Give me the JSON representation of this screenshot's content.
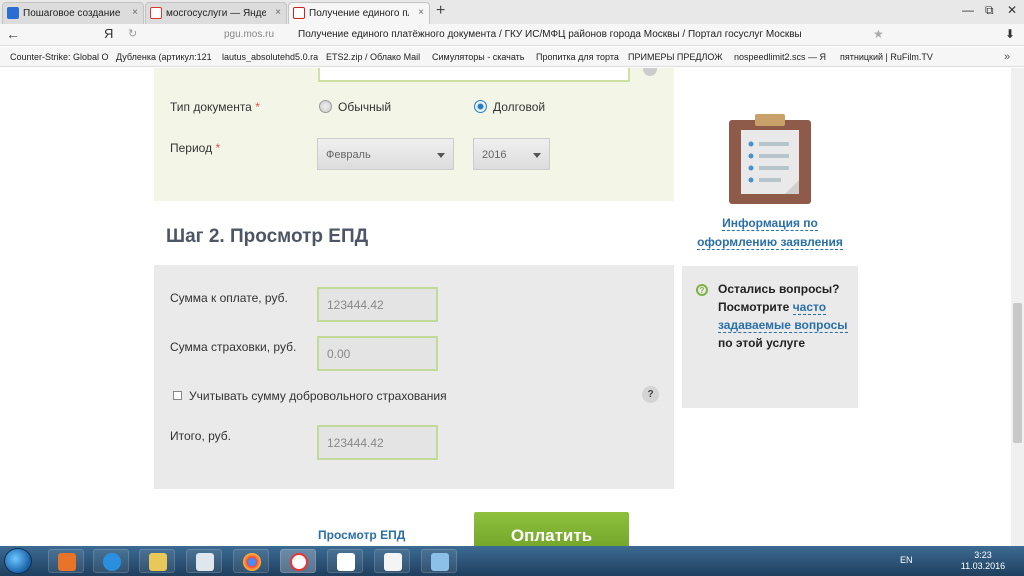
{
  "browser": {
    "tabs": [
      {
        "label": "Пошаговое создание проект",
        "close": "×"
      },
      {
        "label": "мосгосуслуги — Яндекс: нашл",
        "close": "×"
      },
      {
        "label": "Получение единого плат",
        "close": "×"
      }
    ],
    "new_tab": "+",
    "window_controls": {
      "minimize": "—",
      "restore": "⧉",
      "close": "✕"
    },
    "address": {
      "back": "←",
      "ya": "Я",
      "reload": "↻",
      "domain": "pgu.mos.ru",
      "page_title": "Получение единого платёжного документа / ГКУ ИС/МФЦ районов города Москвы / Портал госуслуг Москвы",
      "star": "★",
      "download": "⬇"
    },
    "bookmarks": [
      "Counter-Strike: Global O",
      "Дубленка (артикул:121",
      "lautus_absolutehd5.0.ra",
      "ETS2.zip / Облако Mail",
      "Симуляторы - скачать",
      "Пропитка для торта",
      "ПРИМЕРЫ ПРЕДЛОЖ",
      "nospeedlimit2.scs — Я",
      "пятницкий | RuFilm.TV"
    ],
    "bookmarks_more": "»"
  },
  "form": {
    "doc_type": {
      "label": "Тип документа",
      "required_mark": "*",
      "options": [
        "Обычный",
        "Долговой"
      ],
      "selected": "Долговой"
    },
    "period": {
      "label": "Период",
      "required_mark": "*",
      "month": "Февраль",
      "year": "2016"
    },
    "step2_title": "Шаг 2. Просмотр ЕПД",
    "sum_to_pay": {
      "label": "Сумма к оплате, руб.",
      "value": "123444.42"
    },
    "insurance_sum": {
      "label": "Сумма страховки, руб.",
      "value": "0.00"
    },
    "voluntary_insurance": {
      "label": "Учитывать сумму добровольного страхования",
      "checked": false,
      "help": "?"
    },
    "total": {
      "label": "Итого, руб.",
      "value": "123444.42"
    },
    "view_link": "Просмотр ЕПД",
    "pay_button": "Оплатить"
  },
  "sidebar": {
    "info_link_line1": "Информация по",
    "info_link_line2": "оформлению заявления",
    "help": {
      "icon": "?",
      "text_before": "Остались вопросы? Посмотрите",
      "link": "часто задаваемые вопросы",
      "text_after": "по этой услуге"
    }
  },
  "taskbar": {
    "lang": "EN",
    "time": "3:23",
    "date": "11.03.2016"
  },
  "colors": {
    "accent_green": "#7cb342",
    "link_blue": "#2a6fa8",
    "panel_green": "#f3f6e6",
    "panel_gray": "#eaeaea"
  }
}
